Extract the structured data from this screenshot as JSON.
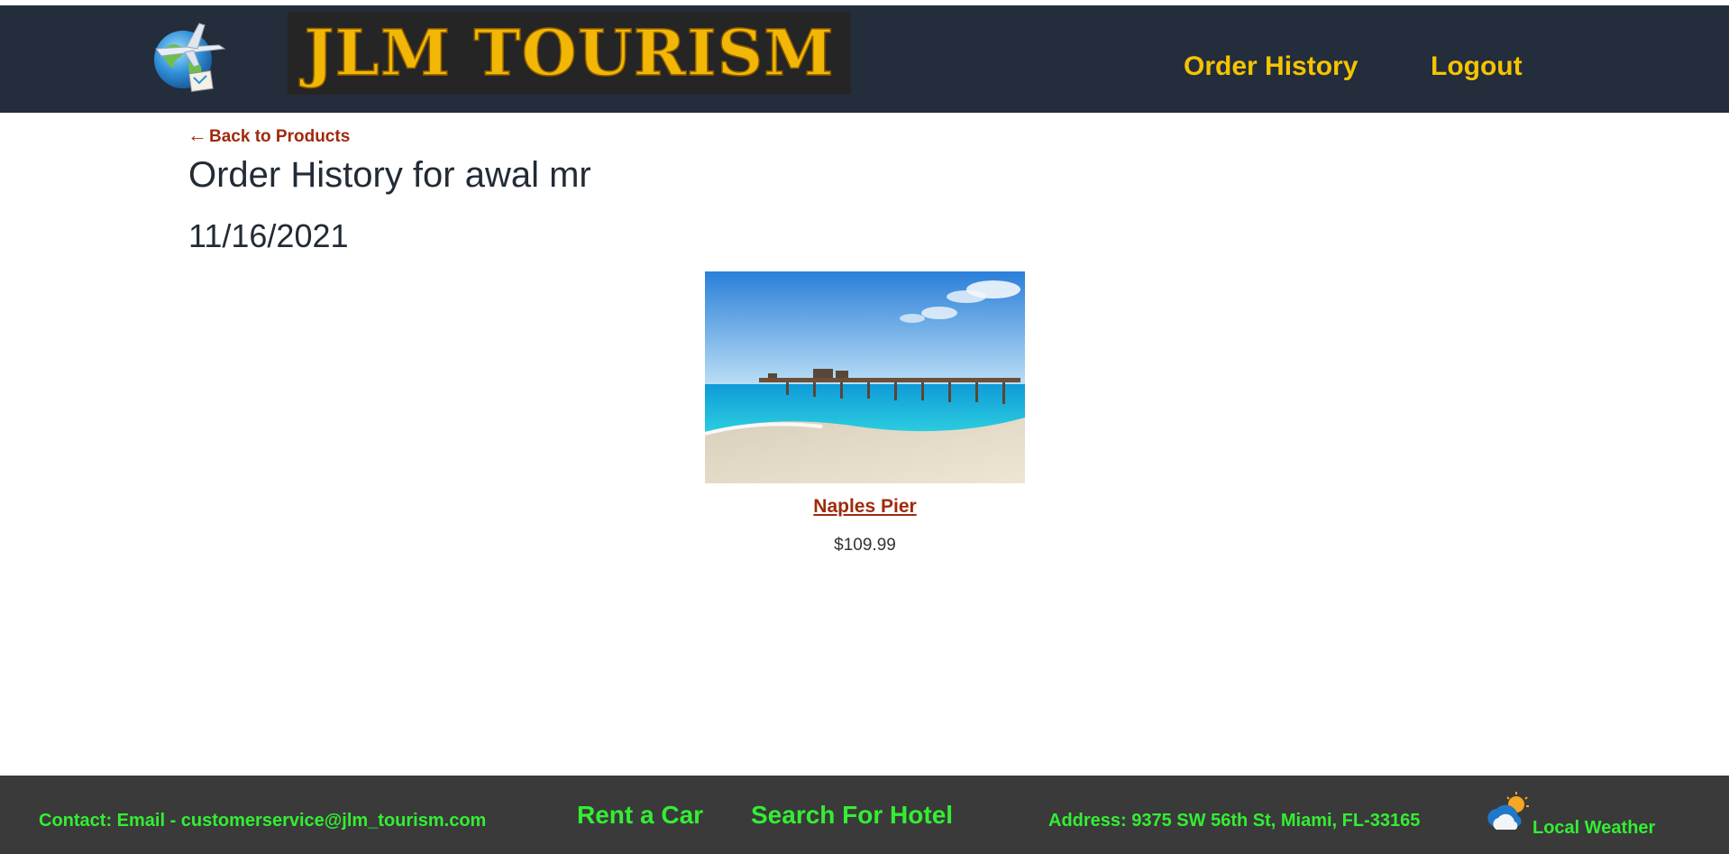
{
  "header": {
    "logo_text": "JLM TOURISM",
    "nav": {
      "order_history": "Order History",
      "logout": "Logout"
    }
  },
  "main": {
    "back_arrow": "←",
    "back_label": "Back to Products",
    "title": "Order History for awal mr",
    "orders": [
      {
        "date": "11/16/2021",
        "items": [
          {
            "name": "Naples Pier",
            "price": "$109.99"
          }
        ]
      }
    ]
  },
  "footer": {
    "contact": "Contact: Email - customerservice@jlm_tourism.com",
    "rent_car": "Rent a Car",
    "search_hotel": "Search For Hotel",
    "address": "Address: 9375 SW 56th St, Miami, FL-33165",
    "weather": "Local Weather"
  },
  "colors": {
    "header_bg": "#232d3c",
    "nav_link": "#f5c400",
    "logo_text": "#f2b705",
    "link_red": "#a02a0c",
    "footer_bg": "#3a3a3a",
    "footer_text": "#33ee33"
  },
  "icons": {
    "brand": "globe-airplane-icon",
    "weather": "sun-cloud-icon"
  }
}
